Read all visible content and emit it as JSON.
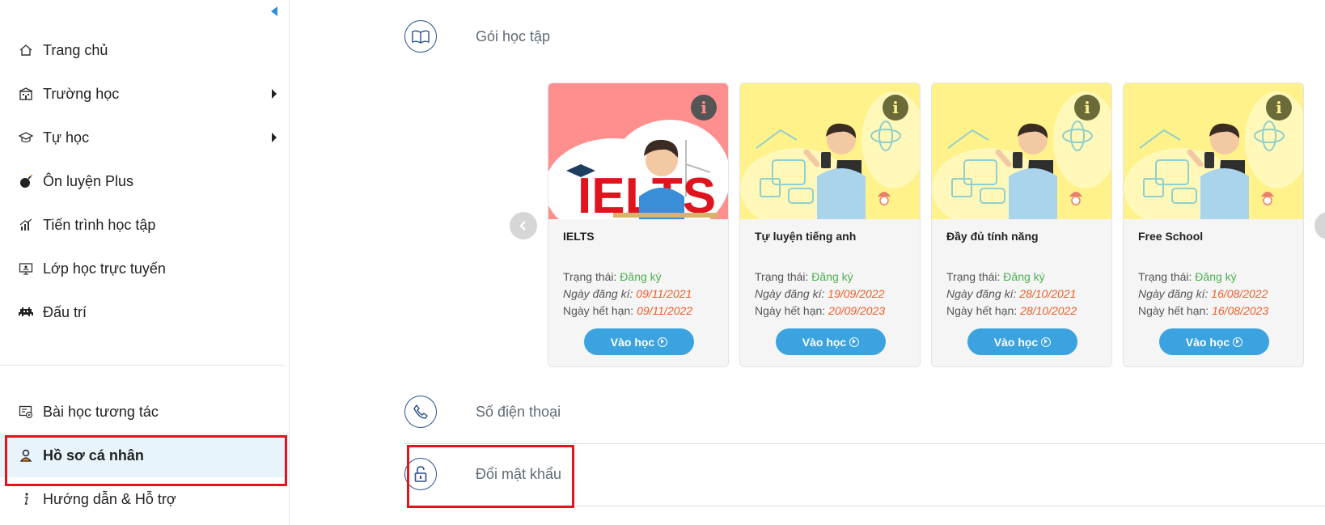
{
  "sidebar": {
    "top_items": [
      {
        "label": "Trang chủ",
        "icon": "home-icon",
        "has_submenu": false
      },
      {
        "label": "Trường học",
        "icon": "school-icon",
        "has_submenu": true
      },
      {
        "label": "Tự học",
        "icon": "graduation-cap-icon",
        "has_submenu": true
      },
      {
        "label": "Ôn luyện Plus",
        "icon": "bomb-icon",
        "has_submenu": false
      },
      {
        "label": "Tiến trình học tập",
        "icon": "chart-progress-icon",
        "has_submenu": false
      },
      {
        "label": "Lớp học trực tuyến",
        "icon": "online-class-icon",
        "has_submenu": false
      },
      {
        "label": "Đấu trí",
        "icon": "space-invader-icon",
        "has_submenu": false
      }
    ],
    "bottom_items": [
      {
        "label": "Bài học tương tác",
        "icon": "interactive-lesson-icon",
        "active": false
      },
      {
        "label": "Hồ sơ cá nhân",
        "icon": "user-icon",
        "active": true
      },
      {
        "label": "Hướng dẫn & Hỗ trợ",
        "icon": "info-icon",
        "active": false
      }
    ]
  },
  "main": {
    "packages_title": "Gói học tập",
    "phone_title": "Số điện thoại",
    "password_title": "Đổi mật khẩu",
    "cards": [
      {
        "title": "IELTS",
        "status_label": "Trạng thái:",
        "status_value": "Đăng ký",
        "reg_label": "Ngày đăng kí:",
        "reg_date": "09/11/2021",
        "exp_label": "Ngày hết hạn:",
        "exp_date": "09/11/2022",
        "button": "Vào học",
        "image": "ielts-banner",
        "image_text": "IELTS"
      },
      {
        "title": "Tự luyện tiếng anh",
        "status_label": "Trạng thái:",
        "status_value": "Đăng ký",
        "reg_label": "Ngày đăng kí:",
        "reg_date": "19/09/2022",
        "exp_label": "Ngày hết hạn:",
        "exp_date": "20/09/2023",
        "button": "Vào học",
        "image": "student-phone-banner"
      },
      {
        "title": "Đầy đủ tính năng",
        "status_label": "Trạng thái:",
        "status_value": "Đăng ký",
        "reg_label": "Ngày đăng kí:",
        "reg_date": "28/10/2021",
        "exp_label": "Ngày hết hạn:",
        "exp_date": "28/10/2022",
        "button": "Vào học",
        "image": "student-phone-banner"
      },
      {
        "title": "Free School",
        "status_label": "Trạng thái:",
        "status_value": "Đăng ký",
        "reg_label": "Ngày đăng kí:",
        "reg_date": "16/08/2022",
        "exp_label": "Ngày hết hạn:",
        "exp_date": "16/08/2023",
        "button": "Vào học",
        "image": "student-phone-banner"
      }
    ]
  },
  "colors": {
    "accent_blue": "#3aa3e0",
    "active_bg": "#e8f4fb",
    "highlight_red": "#e6131b",
    "status_green": "#4caf50",
    "date_orange": "#f05a28",
    "ielts_bg": "#ff8f8f",
    "banner_yellow": "#fff28a"
  }
}
